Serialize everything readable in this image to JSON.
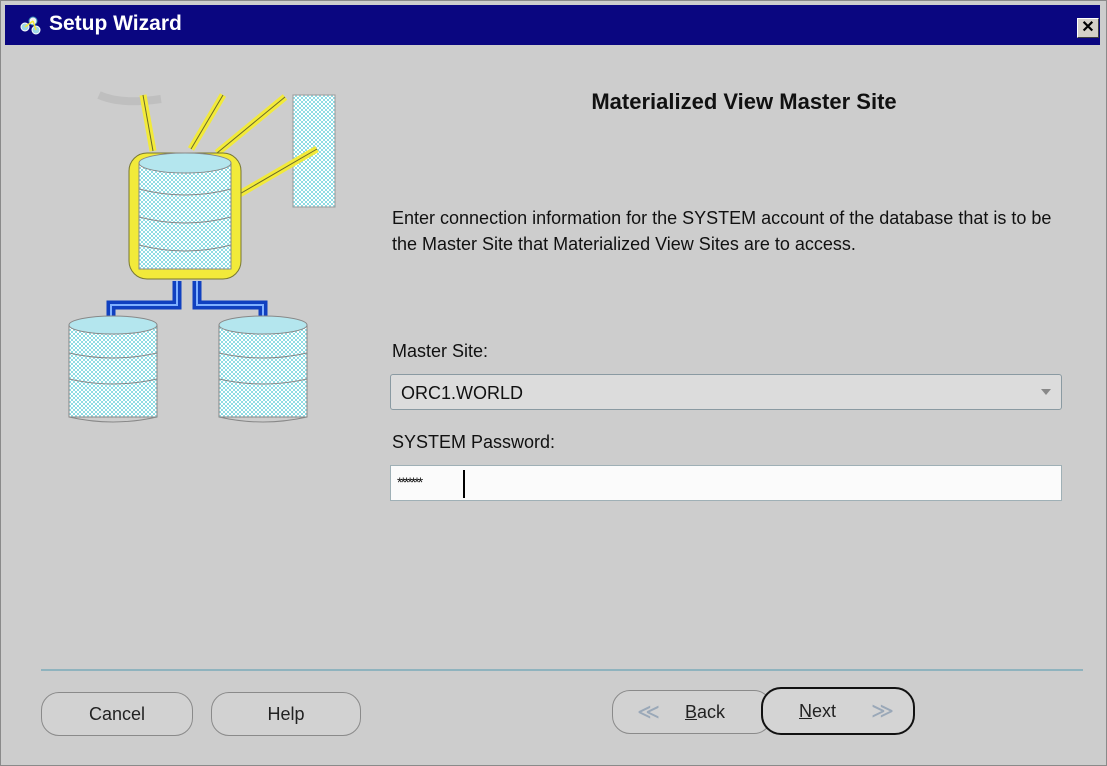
{
  "window": {
    "title": "Setup Wizard",
    "close_glyph": "✕",
    "title_icon": "wizard-icon"
  },
  "page": {
    "heading": "Materialized View Master Site",
    "description": "Enter connection information for the SYSTEM account of the database that is to be the Master Site that Materialized View Sites are to access.",
    "illustration": "database-replication-illustration"
  },
  "form": {
    "master_site_label": "Master Site:",
    "master_site_value": "ORC1.WORLD",
    "password_label": "SYSTEM Password:",
    "password_value": "*******"
  },
  "buttons": {
    "cancel": "Cancel",
    "help": "Help",
    "back": "Back",
    "next": "Next",
    "back_icon": "chevron-left-icon",
    "next_icon": "chevron-right-icon"
  },
  "colors": {
    "titlebar": "#0a0680",
    "background": "#cdcdcd",
    "divider": "#8fb3be",
    "highlight": "#f2ea3a",
    "pipe": "#1040c0",
    "db_cyan": "#8fdce4"
  }
}
